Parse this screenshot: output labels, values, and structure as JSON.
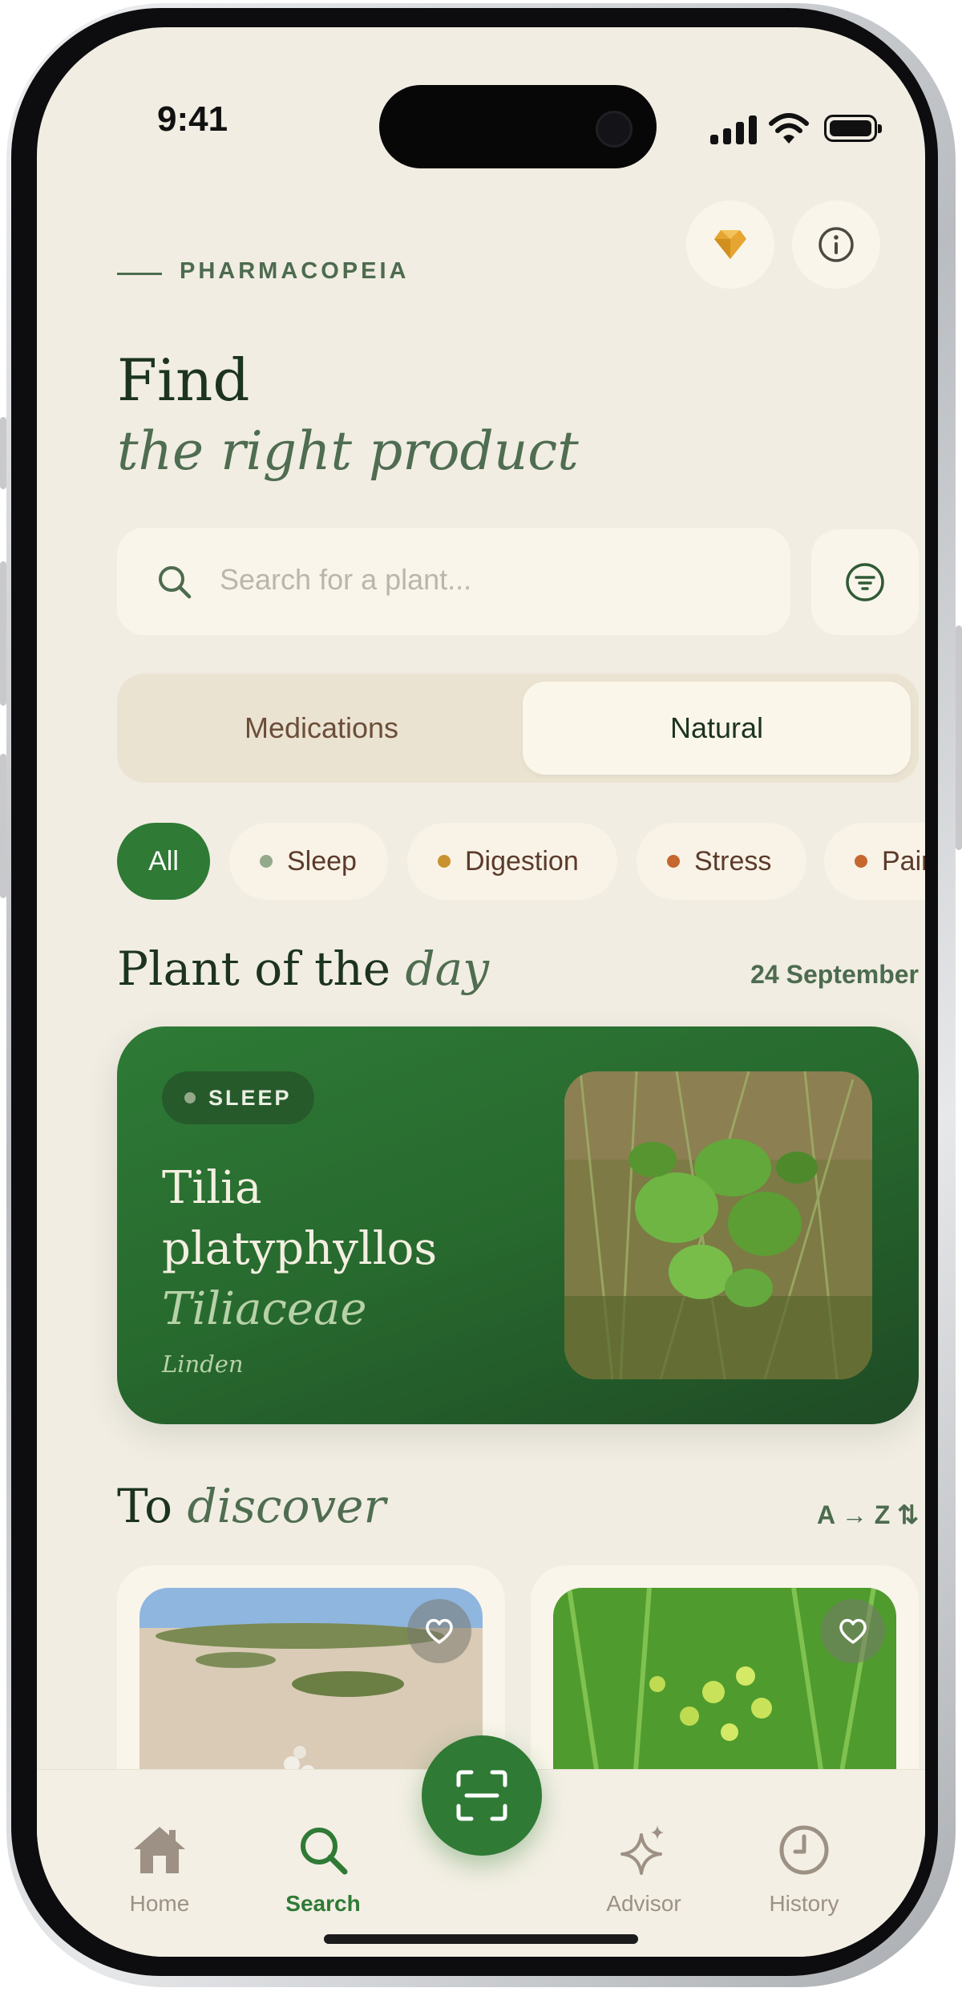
{
  "status": {
    "time": "9:41"
  },
  "header": {
    "brand": "PHARMACOPEIA",
    "title_line1": "Find",
    "title_line2": "the right product"
  },
  "search": {
    "placeholder": "Search for a plant..."
  },
  "segment": {
    "options": [
      "Medications",
      "Natural"
    ],
    "selected": "Natural"
  },
  "chips": [
    {
      "label": "All",
      "selected": true
    },
    {
      "label": "Sleep",
      "dot_color": "#93a98a"
    },
    {
      "label": "Digestion",
      "dot_color": "#c9922e"
    },
    {
      "label": "Stress",
      "dot_color": "#c5672f"
    },
    {
      "label": "Pain",
      "dot_color": "#c5672f"
    }
  ],
  "plant_of_day": {
    "section_title": "Plant of the",
    "section_title_italic": "day",
    "date": "24 September",
    "badge": "SLEEP",
    "name_line1": "Tilia",
    "name_line2": "platyphyllos",
    "family": "Tiliaceae",
    "common_name": "Linden"
  },
  "discover": {
    "section_title": "To",
    "section_title_italic": "discover",
    "sort_label": "A → Z"
  },
  "tabbar": {
    "items": [
      {
        "label": "Home",
        "icon": "home-icon"
      },
      {
        "label": "Search",
        "icon": "search-icon",
        "active": true
      },
      {
        "label": "Advisor",
        "icon": "sparkle-icon"
      },
      {
        "label": "History",
        "icon": "clock-icon"
      }
    ],
    "center_action_icon": "scan-icon"
  },
  "colors": {
    "accent_green": "#2f7a35",
    "background": "#f1ede3",
    "card": "#f9f5ea",
    "title_green": "#1c3320"
  }
}
